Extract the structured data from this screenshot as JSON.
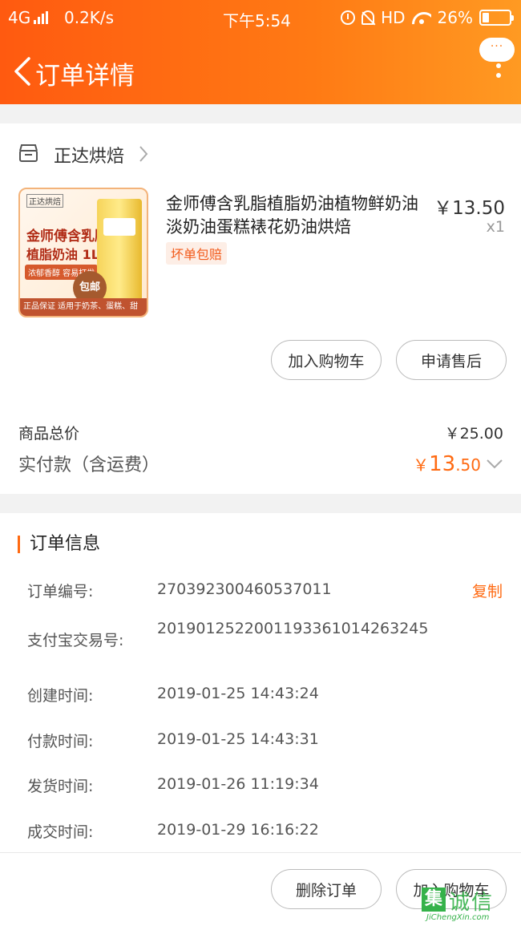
{
  "status_bar": {
    "network": "4G",
    "speed": "0.2K/s",
    "time": "下午5:54",
    "hd": "HD",
    "battery_text": "26%",
    "battery_level": 0.26
  },
  "nav": {
    "title": "订单详情",
    "more_bubble": "···"
  },
  "store": {
    "name": "正达烘焙"
  },
  "product": {
    "title": "金师傅含乳脂植脂奶油植物鲜奶油淡奶油蛋糕裱花奶油烘焙",
    "badge": "坏单包赔",
    "price": "￥13.50",
    "qty": "x1",
    "image": {
      "brand": "正达烘焙",
      "line1": "金师傅含乳脂",
      "line2": "植脂奶油 1L",
      "line3": "浓郁香醇 容易打发",
      "baoyou": "包邮",
      "guarantee": "正品保证  适用于奶茶、蛋糕、甜品、面包等"
    }
  },
  "product_actions": {
    "add_cart": "加入购物车",
    "after_sale": "申请售后"
  },
  "summary": {
    "total_label": "商品总价",
    "total_value": "￥25.00",
    "paid_label": "实付款（含运费）",
    "paid_currency": "￥",
    "paid_int": "13",
    "paid_dec": ".50"
  },
  "order_info": {
    "heading": "订单信息",
    "copy_label": "复制",
    "rows": [
      {
        "key": "订单编号:",
        "value": "270392300460537011"
      },
      {
        "key": "支付宝交易号:",
        "value": "2019012522001193361014263245"
      },
      {
        "key": "创建时间:",
        "value": "2019-01-25 14:43:24"
      },
      {
        "key": "付款时间:",
        "value": "2019-01-25 14:43:31"
      },
      {
        "key": "发货时间:",
        "value": "2019-01-26 11:19:34"
      },
      {
        "key": "成交时间:",
        "value": "2019-01-29 16:16:22"
      }
    ]
  },
  "bottom_actions": {
    "delete_order": "删除订单",
    "add_cart": "加入购物车"
  },
  "watermark": {
    "mark": "集",
    "text": "诚信",
    "sub": "JiChengXin.com"
  }
}
